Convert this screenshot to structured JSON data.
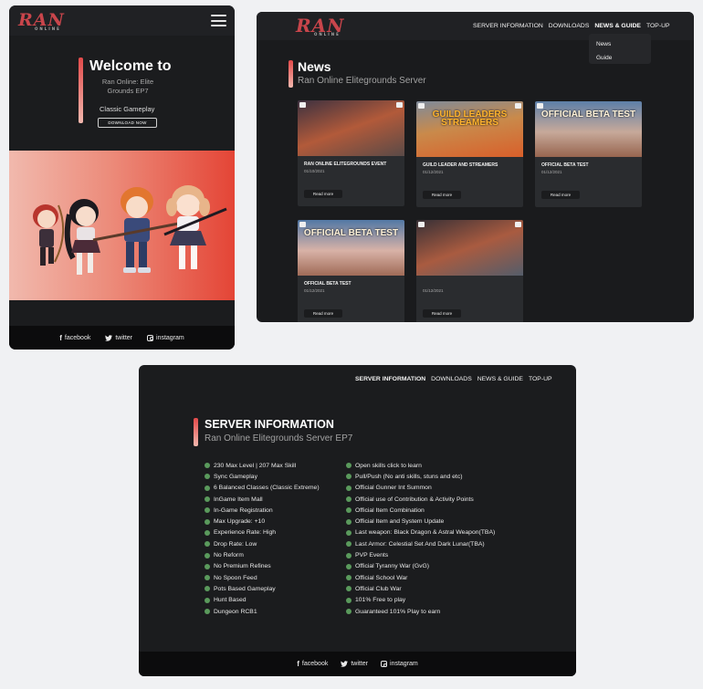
{
  "brand": {
    "logo_text": "RAN",
    "logo_sub": "ONLINE"
  },
  "mobile_home": {
    "hero": {
      "title": "Welcome to",
      "subtitle": "Ran Online: Elite Grounds EP7",
      "tagline": "Classic Gameplay",
      "download_button": "DOWNLOAD NOW"
    }
  },
  "nav": {
    "items": [
      "SERVER INFORMATION",
      "DOWNLOADS",
      "NEWS & GUIDE",
      "TOP-UP"
    ],
    "dropdown": [
      "News",
      "Guide"
    ]
  },
  "news_page": {
    "title": "News",
    "subtitle": "Ran Online Elitegrounds Server",
    "read_more": "Read more",
    "cards": [
      {
        "title": "RAN ONLINE ELITEGROUNDS EVENT",
        "date": "01/10/2021",
        "thumb_text": ""
      },
      {
        "title": "GUILD LEADER AND STREAMERS",
        "date": "01/12/2021",
        "thumb_text": "GUILD LEADERS STREAMERS"
      },
      {
        "title": "OFFICIAL BETA TEST",
        "date": "01/12/2021",
        "thumb_text": "OFFICIAL BETA TEST"
      },
      {
        "title": "OFFICIAL BETA TEST",
        "date": "01/12/2021",
        "thumb_text": "OFFICIAL BETA TEST"
      },
      {
        "title": "",
        "date": "01/12/2021",
        "thumb_text": ""
      }
    ]
  },
  "server_info": {
    "title": "SERVER INFORMATION",
    "subtitle": "Ran Online Elitegrounds Server EP7",
    "features_left": [
      "230 Max Level | 207 Max Skill",
      "Sync Gameplay",
      "6 Balanced Classes (Classic Extreme)",
      "InGame Item Mall",
      "In-Game Registration",
      "Max Upgrade: +10",
      "Experience Rate: High",
      "Drop Rate: Low",
      "No Reform",
      "No Premium Refines",
      "No Spoon Feed",
      "Pots Based Gameplay",
      "Hunt Based",
      "Dungeon RCB1"
    ],
    "features_right": [
      "Open skills click to learn",
      "Pull/Push (No anti skills, stuns and etc)",
      "Official Gunner Int Summon",
      "Official use of Contribution & Activity Points",
      "Official Item Combination",
      "Official Item and System Update",
      "Last weapon: Black Dragon & Astral Weapon(TBA)",
      "Last Armor: Celestial Set And Dark Lunar(TBA)",
      "PVP Events",
      "Official Tyranny War (GvG)",
      "Official School War",
      "Official Club War",
      "101% Free to play",
      "Guaranteed 101% Play to earn"
    ]
  },
  "footer": {
    "facebook": "facebook",
    "twitter": "twitter",
    "instagram": "instagram"
  },
  "colors": {
    "accent": "#e24a4a",
    "bullet": "#5a9a5c",
    "panel_bg": "#1b1c1e"
  }
}
